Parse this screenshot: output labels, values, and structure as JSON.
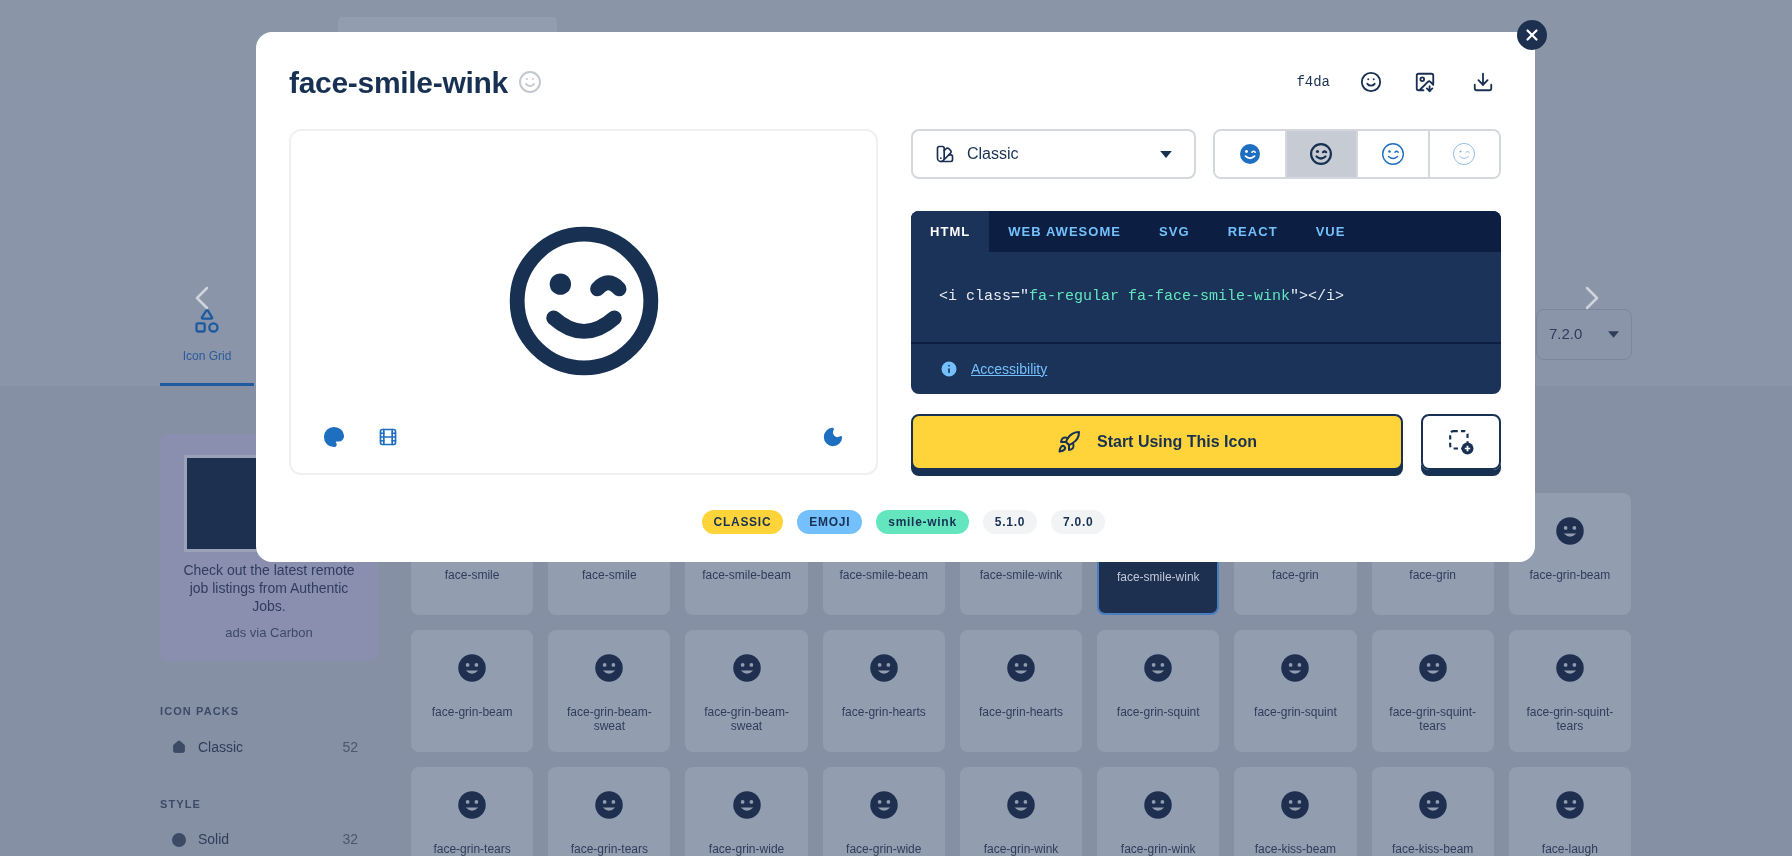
{
  "background": {
    "nav_tab": {
      "label": "Icon Grid",
      "selected": true
    },
    "version_select": {
      "value": "7.2.0"
    },
    "ad": {
      "text": "Check out the latest remote job listings from Authentic Jobs.",
      "credit": "ads via Carbon"
    },
    "sidebar": [
      {
        "kind": "pack",
        "heading": "ICON PACKS",
        "items": [
          {
            "label": "Classic",
            "count": "52"
          }
        ]
      },
      {
        "kind": "style",
        "heading": "STYLE",
        "items": [
          {
            "label": "Solid",
            "count": "32"
          }
        ]
      }
    ],
    "icon_grid": [
      {
        "label": "face-smile",
        "selected": false
      },
      {
        "label": "face-smile",
        "selected": false
      },
      {
        "label": "face-smile-beam",
        "selected": false
      },
      {
        "label": "face-smile-beam",
        "selected": false
      },
      {
        "label": "face-smile-wink",
        "selected": false
      },
      {
        "label": "face-smile-wink",
        "selected": true
      },
      {
        "label": "face-grin",
        "selected": false
      },
      {
        "label": "face-grin",
        "selected": false
      },
      {
        "label": "face-grin-beam",
        "selected": false
      },
      {
        "label": "face-grin-beam",
        "selected": false
      },
      {
        "label": "face-grin-beam-sweat",
        "selected": false
      },
      {
        "label": "face-grin-beam-sweat",
        "selected": false
      },
      {
        "label": "face-grin-hearts",
        "selected": false
      },
      {
        "label": "face-grin-hearts",
        "selected": false
      },
      {
        "label": "face-grin-squint",
        "selected": false
      },
      {
        "label": "face-grin-squint",
        "selected": false
      },
      {
        "label": "face-grin-squint-tears",
        "selected": false
      },
      {
        "label": "face-grin-squint-tears",
        "selected": false
      },
      {
        "label": "face-grin-tears",
        "selected": false
      },
      {
        "label": "face-grin-tears",
        "selected": false
      },
      {
        "label": "face-grin-wide",
        "selected": false
      },
      {
        "label": "face-grin-wide",
        "selected": false
      },
      {
        "label": "face-grin-wink",
        "selected": false
      },
      {
        "label": "face-grin-wink",
        "selected": false
      },
      {
        "label": "face-kiss-beam",
        "selected": false
      },
      {
        "label": "face-kiss-beam",
        "selected": false
      },
      {
        "label": "face-laugh",
        "selected": false
      }
    ]
  },
  "modal": {
    "title": "face-smile-wink",
    "unicode": "f4da",
    "family_select": {
      "value": "Classic"
    },
    "styles": [
      {
        "kind": "solid",
        "selected": false
      },
      {
        "kind": "regular",
        "selected": true
      },
      {
        "kind": "light",
        "selected": false
      },
      {
        "kind": "thin",
        "selected": false
      }
    ],
    "code_tabs": [
      {
        "label": "HTML",
        "selected": true
      },
      {
        "label": "WEB AWESOME",
        "selected": false
      },
      {
        "label": "SVG",
        "selected": false
      },
      {
        "label": "REACT",
        "selected": false
      },
      {
        "label": "VUE",
        "selected": false
      }
    ],
    "code": [
      {
        "kind": "plain",
        "text": "<i class=\""
      },
      {
        "kind": "string",
        "text": "fa-regular fa-face-smile-wink"
      },
      {
        "kind": "plain",
        "text": "\"></i>"
      }
    ],
    "accessibility_link": "Accessibility",
    "primary_button": "Start Using This Icon",
    "tags": [
      {
        "label": "CLASSIC",
        "color": "#ffd43b"
      },
      {
        "label": "EMOJI",
        "color": "#74c0fc"
      },
      {
        "label": "smile-wink",
        "color": "#63e6be"
      },
      {
        "label": "5.1.0",
        "color": "#f1f3f5"
      },
      {
        "label": "7.0.0",
        "color": "#f1f3f5"
      }
    ]
  }
}
